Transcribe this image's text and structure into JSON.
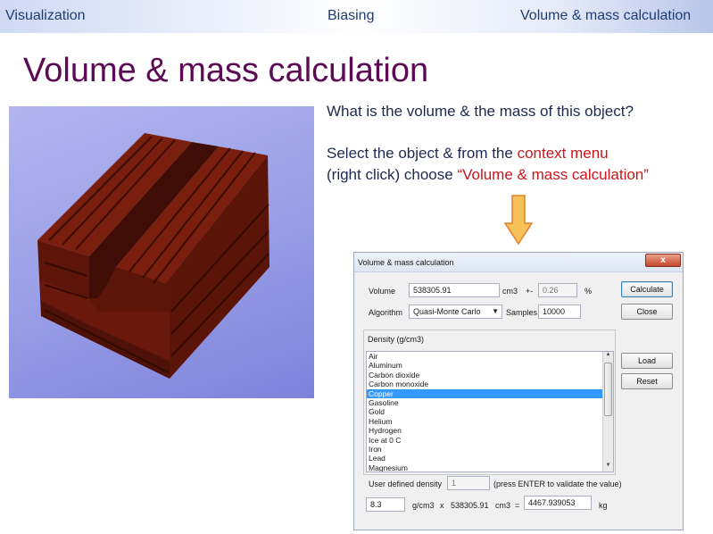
{
  "nav": {
    "item1": "Visualization",
    "item2": "Biasing",
    "item3": "Volume & mass calculation"
  },
  "slide": {
    "title": "Volume & mass calculation",
    "question": "What is the volume & the mass of this object?",
    "instruction_pre": "Select the object & from the ",
    "instruction_highlight1": "context menu",
    "instruction_line2_pre": "(right click) choose ",
    "instruction_highlight2": "“Volume & mass calculation”"
  },
  "colors": {
    "title": "#5c0a55",
    "highlight": "#c9161b",
    "object": "#6b1a0c",
    "viewport_bg": "#9a9fe6",
    "arrow": "#f7c15a"
  },
  "dialog": {
    "title": "Volume & mass calculation",
    "close_glyph": "x",
    "volume_label": "Volume",
    "volume_value": "538305.91",
    "volume_unit": "cm3",
    "plusminus": "+-",
    "error_value": "0.26",
    "error_unit": "%",
    "calculate_label": "Calculate",
    "algorithm_label": "Algorithm",
    "algorithm_value": "Quasi-Monte Carlo",
    "samples_label": "Samples",
    "samples_value": "10000",
    "close_label": "Close",
    "density_label": "Density (g/cm3)",
    "load_label": "Load",
    "reset_label": "Reset",
    "materials": [
      "Air",
      "Aluminum",
      "Carbon dioxide",
      "Carbon monoxide",
      "Copper",
      "Gasoline",
      "Gold",
      "Helium",
      "Hydrogen",
      "Ice at 0 C",
      "Iron",
      "Lead",
      "Magnesium"
    ],
    "selected_material": "Copper",
    "user_density_label": "User defined density",
    "user_density_value": "1",
    "enter_hint": "(press ENTER to validate the value)",
    "density_value": "8.3",
    "density_unit": "g/cm3",
    "times": "x",
    "volume_repeat": "538305.91",
    "volume_unit2": "cm3",
    "equals": "=",
    "mass_value": "4467.939053",
    "mass_unit": "kg"
  }
}
